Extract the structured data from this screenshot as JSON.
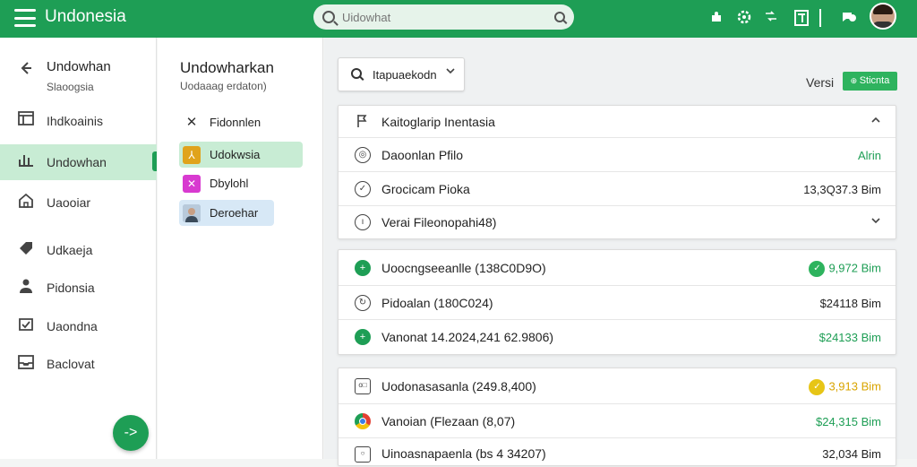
{
  "app": {
    "title": "Undonesia",
    "brand_color": "#1e9e55"
  },
  "search": {
    "placeholder": "Uidowhat"
  },
  "topbar_icons": [
    "menu-icon",
    "puzzle-icon",
    "gear-icon",
    "shuffle-icon",
    "document-icon",
    "chat-icon",
    "avatar"
  ],
  "sidebar": {
    "back_label": "Undowhan",
    "back_sub": "Slaoogsia",
    "items": [
      {
        "label": "Ihdkoainis",
        "icon": "table-icon"
      },
      {
        "label": "Undowhan",
        "icon": "chart-icon",
        "active": true
      },
      {
        "label": "Uaooiar",
        "icon": "home-icon"
      },
      {
        "label": "Udkaeja",
        "icon": "tag-icon"
      },
      {
        "label": "Pidonsia",
        "icon": "person-icon"
      },
      {
        "label": "Uaondna",
        "icon": "shield-icon"
      },
      {
        "label": "Baclovat",
        "icon": "inbox-icon"
      }
    ],
    "fab_glyph": "->"
  },
  "midpanel": {
    "title": "Undowharkan",
    "subtitle": "Uodaaag erdaton)",
    "items": [
      {
        "label": "Fidonnlen",
        "icon_glyph": "X",
        "icon_color": "transparent"
      },
      {
        "label": "Udokwsia",
        "icon_glyph": "A",
        "icon_color": "#e0a31c",
        "selected": "green"
      },
      {
        "label": "Dbylohl",
        "icon_glyph": "X",
        "icon_color": "#d83ad0"
      },
      {
        "label": "Deroehar",
        "icon_glyph": "",
        "icon_color": "#a0b8d0",
        "selected": "blue"
      }
    ]
  },
  "toolbar": {
    "dropdown_label": "Itapuaekodn",
    "versi_label": "Versi",
    "status_label": "Sticnta"
  },
  "card1": {
    "rows": [
      {
        "label": "Kaitoglarip Inentasia",
        "icon": "flag-icon",
        "right": "^",
        "right_type": "chevron"
      },
      {
        "label": "Daoonlan Pfilo",
        "icon": "circle-icon",
        "right": "Alrin",
        "right_type": "green"
      },
      {
        "label": "Grocicam Pioka",
        "icon": "check-circle-icon",
        "right": "13,3Q37.3 Bim",
        "right_type": "plain"
      },
      {
        "label": "Verai Fileonopahi48)",
        "icon": "clock-icon",
        "right": "v",
        "right_type": "chevron"
      }
    ]
  },
  "card2": {
    "rows": [
      {
        "label": "Uoocngseeanlle (138C0D9O)",
        "icon": "green-icon",
        "right": "9,972 Bim",
        "right_type": "green",
        "badge_color": "#1e9e55"
      },
      {
        "label": "Pidoalan (180C024)",
        "icon": "refresh-icon",
        "right": "$24118 Bim",
        "right_type": "plain"
      },
      {
        "label": "Vanonat 14.2024,241 62.9806)",
        "icon": "green-icon",
        "right": "$24133 Bim",
        "right_type": "green"
      }
    ]
  },
  "card3": {
    "rows": [
      {
        "label": "Uodonasasanla (249.8,400)",
        "icon": "box-icon",
        "right": "3,913 Bim",
        "right_type": "gold",
        "badge_color": "#e7c516"
      },
      {
        "label": "Vanoian (Flezaan (8,07)",
        "icon": "chrome-icon",
        "right": "$24,315 Bim",
        "right_type": "green"
      },
      {
        "label": "Uinoasnapaenla (bs 4 34207)",
        "icon": "box-icon",
        "right": "32,034 Bim",
        "right_type": "plain"
      }
    ]
  }
}
